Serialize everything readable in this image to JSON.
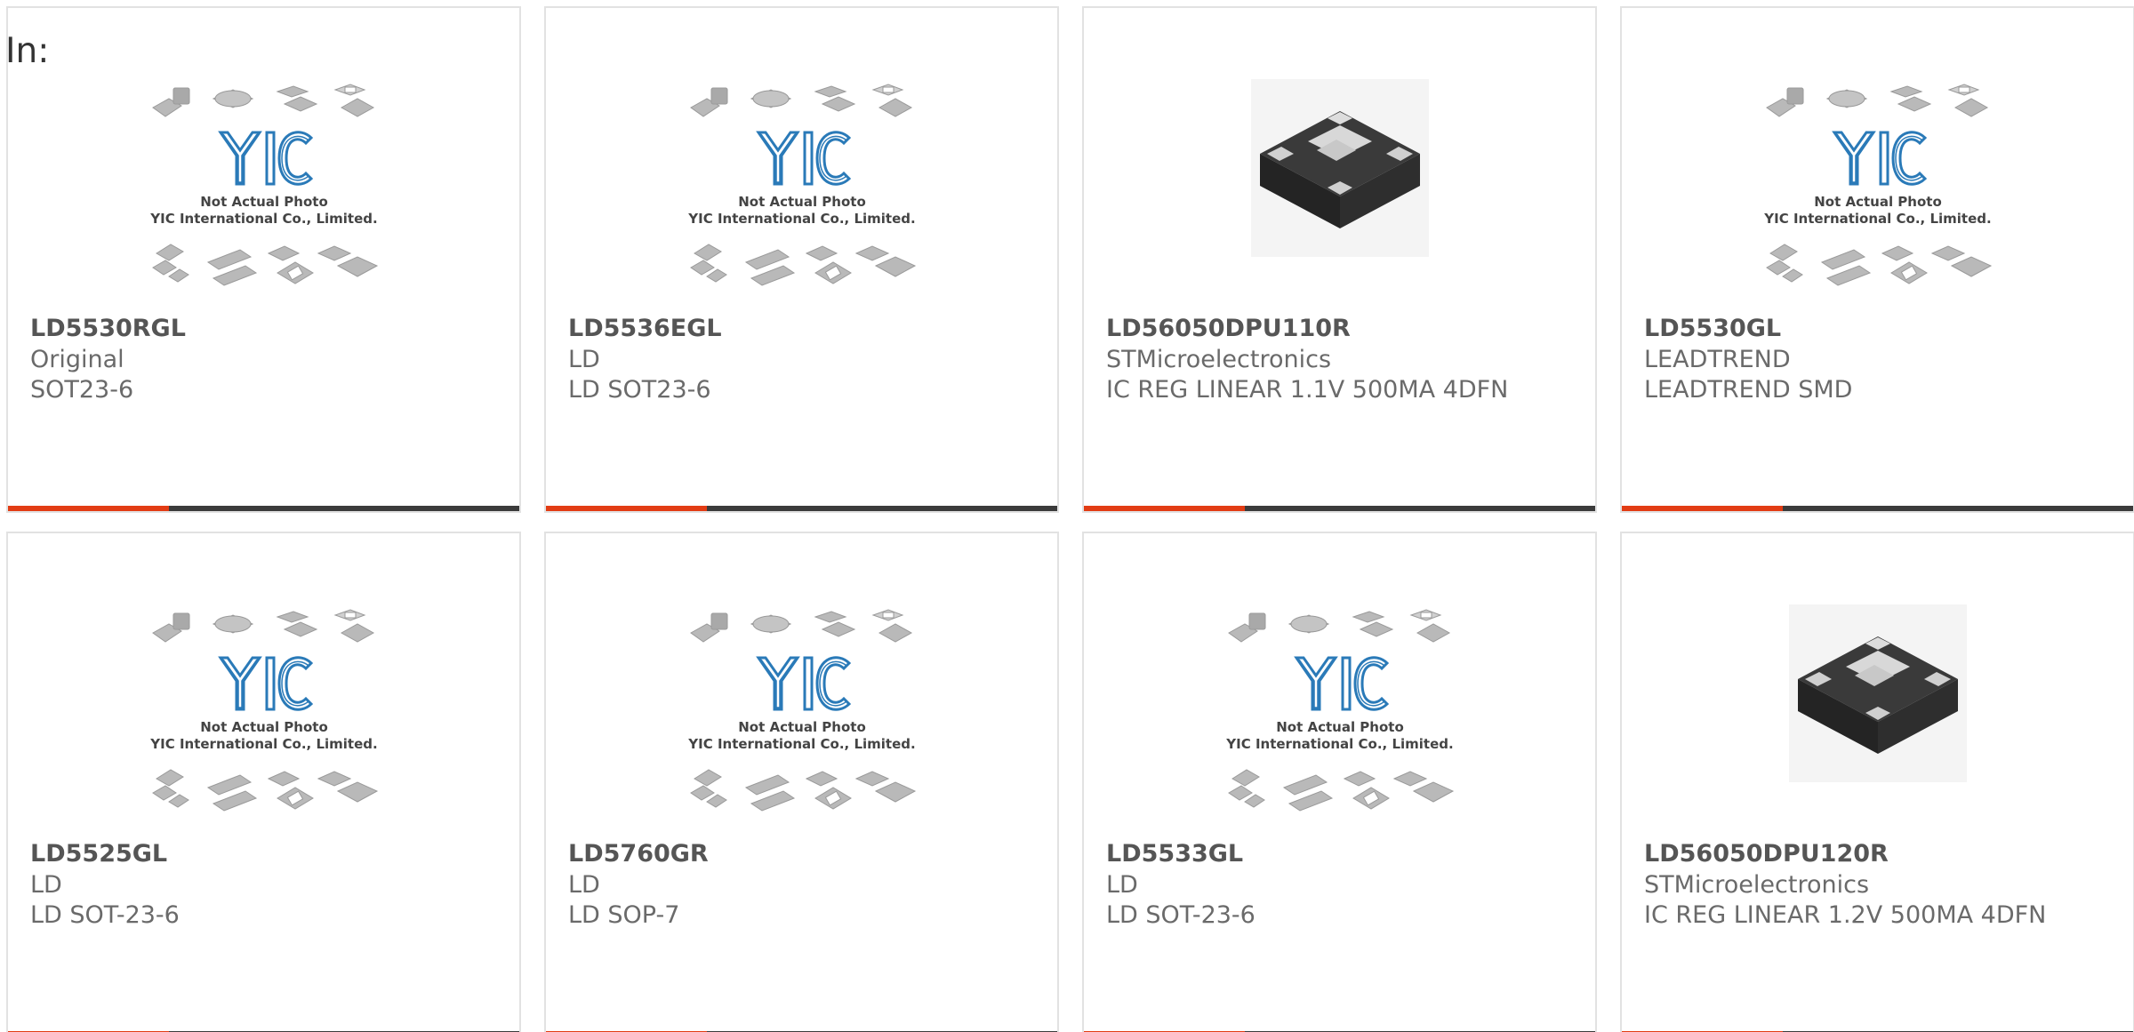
{
  "header": {
    "prefix": "In:"
  },
  "placeholder_image": {
    "caption_line1": "Not Actual Photo",
    "caption_line2": "YIC International Co., Limited."
  },
  "colors": {
    "accent": "#e23c14",
    "bar": "#3b3b3b",
    "logo_blue": "#2a7ab8",
    "text_bold": "#555555",
    "text": "#6a6a6a",
    "border": "#e2e2e2"
  },
  "products": [
    {
      "part": "LD5530RGL",
      "manufacturer": "Original",
      "description": "SOT23-6",
      "image": "placeholder"
    },
    {
      "part": "LD5536EGL",
      "manufacturer": "LD",
      "description": "LD SOT23-6",
      "image": "placeholder"
    },
    {
      "part": "LD56050DPU110R",
      "manufacturer": "STMicroelectronics",
      "description": "IC REG LINEAR 1.1V 500MA 4DFN",
      "image": "chip-photo"
    },
    {
      "part": "LD5530GL",
      "manufacturer": "LEADTREND",
      "description": "LEADTREND SMD",
      "image": "placeholder"
    },
    {
      "part": "LD5525GL",
      "manufacturer": "LD",
      "description": "LD SOT-23-6",
      "image": "placeholder"
    },
    {
      "part": "LD5760GR",
      "manufacturer": "LD",
      "description": "LD SOP-7",
      "image": "placeholder"
    },
    {
      "part": "LD5533GL",
      "manufacturer": "LD",
      "description": "LD SOT-23-6",
      "image": "placeholder"
    },
    {
      "part": "LD56050DPU120R",
      "manufacturer": "STMicroelectronics",
      "description": "IC REG LINEAR 1.2V 500MA 4DFN",
      "image": "chip-photo"
    }
  ]
}
